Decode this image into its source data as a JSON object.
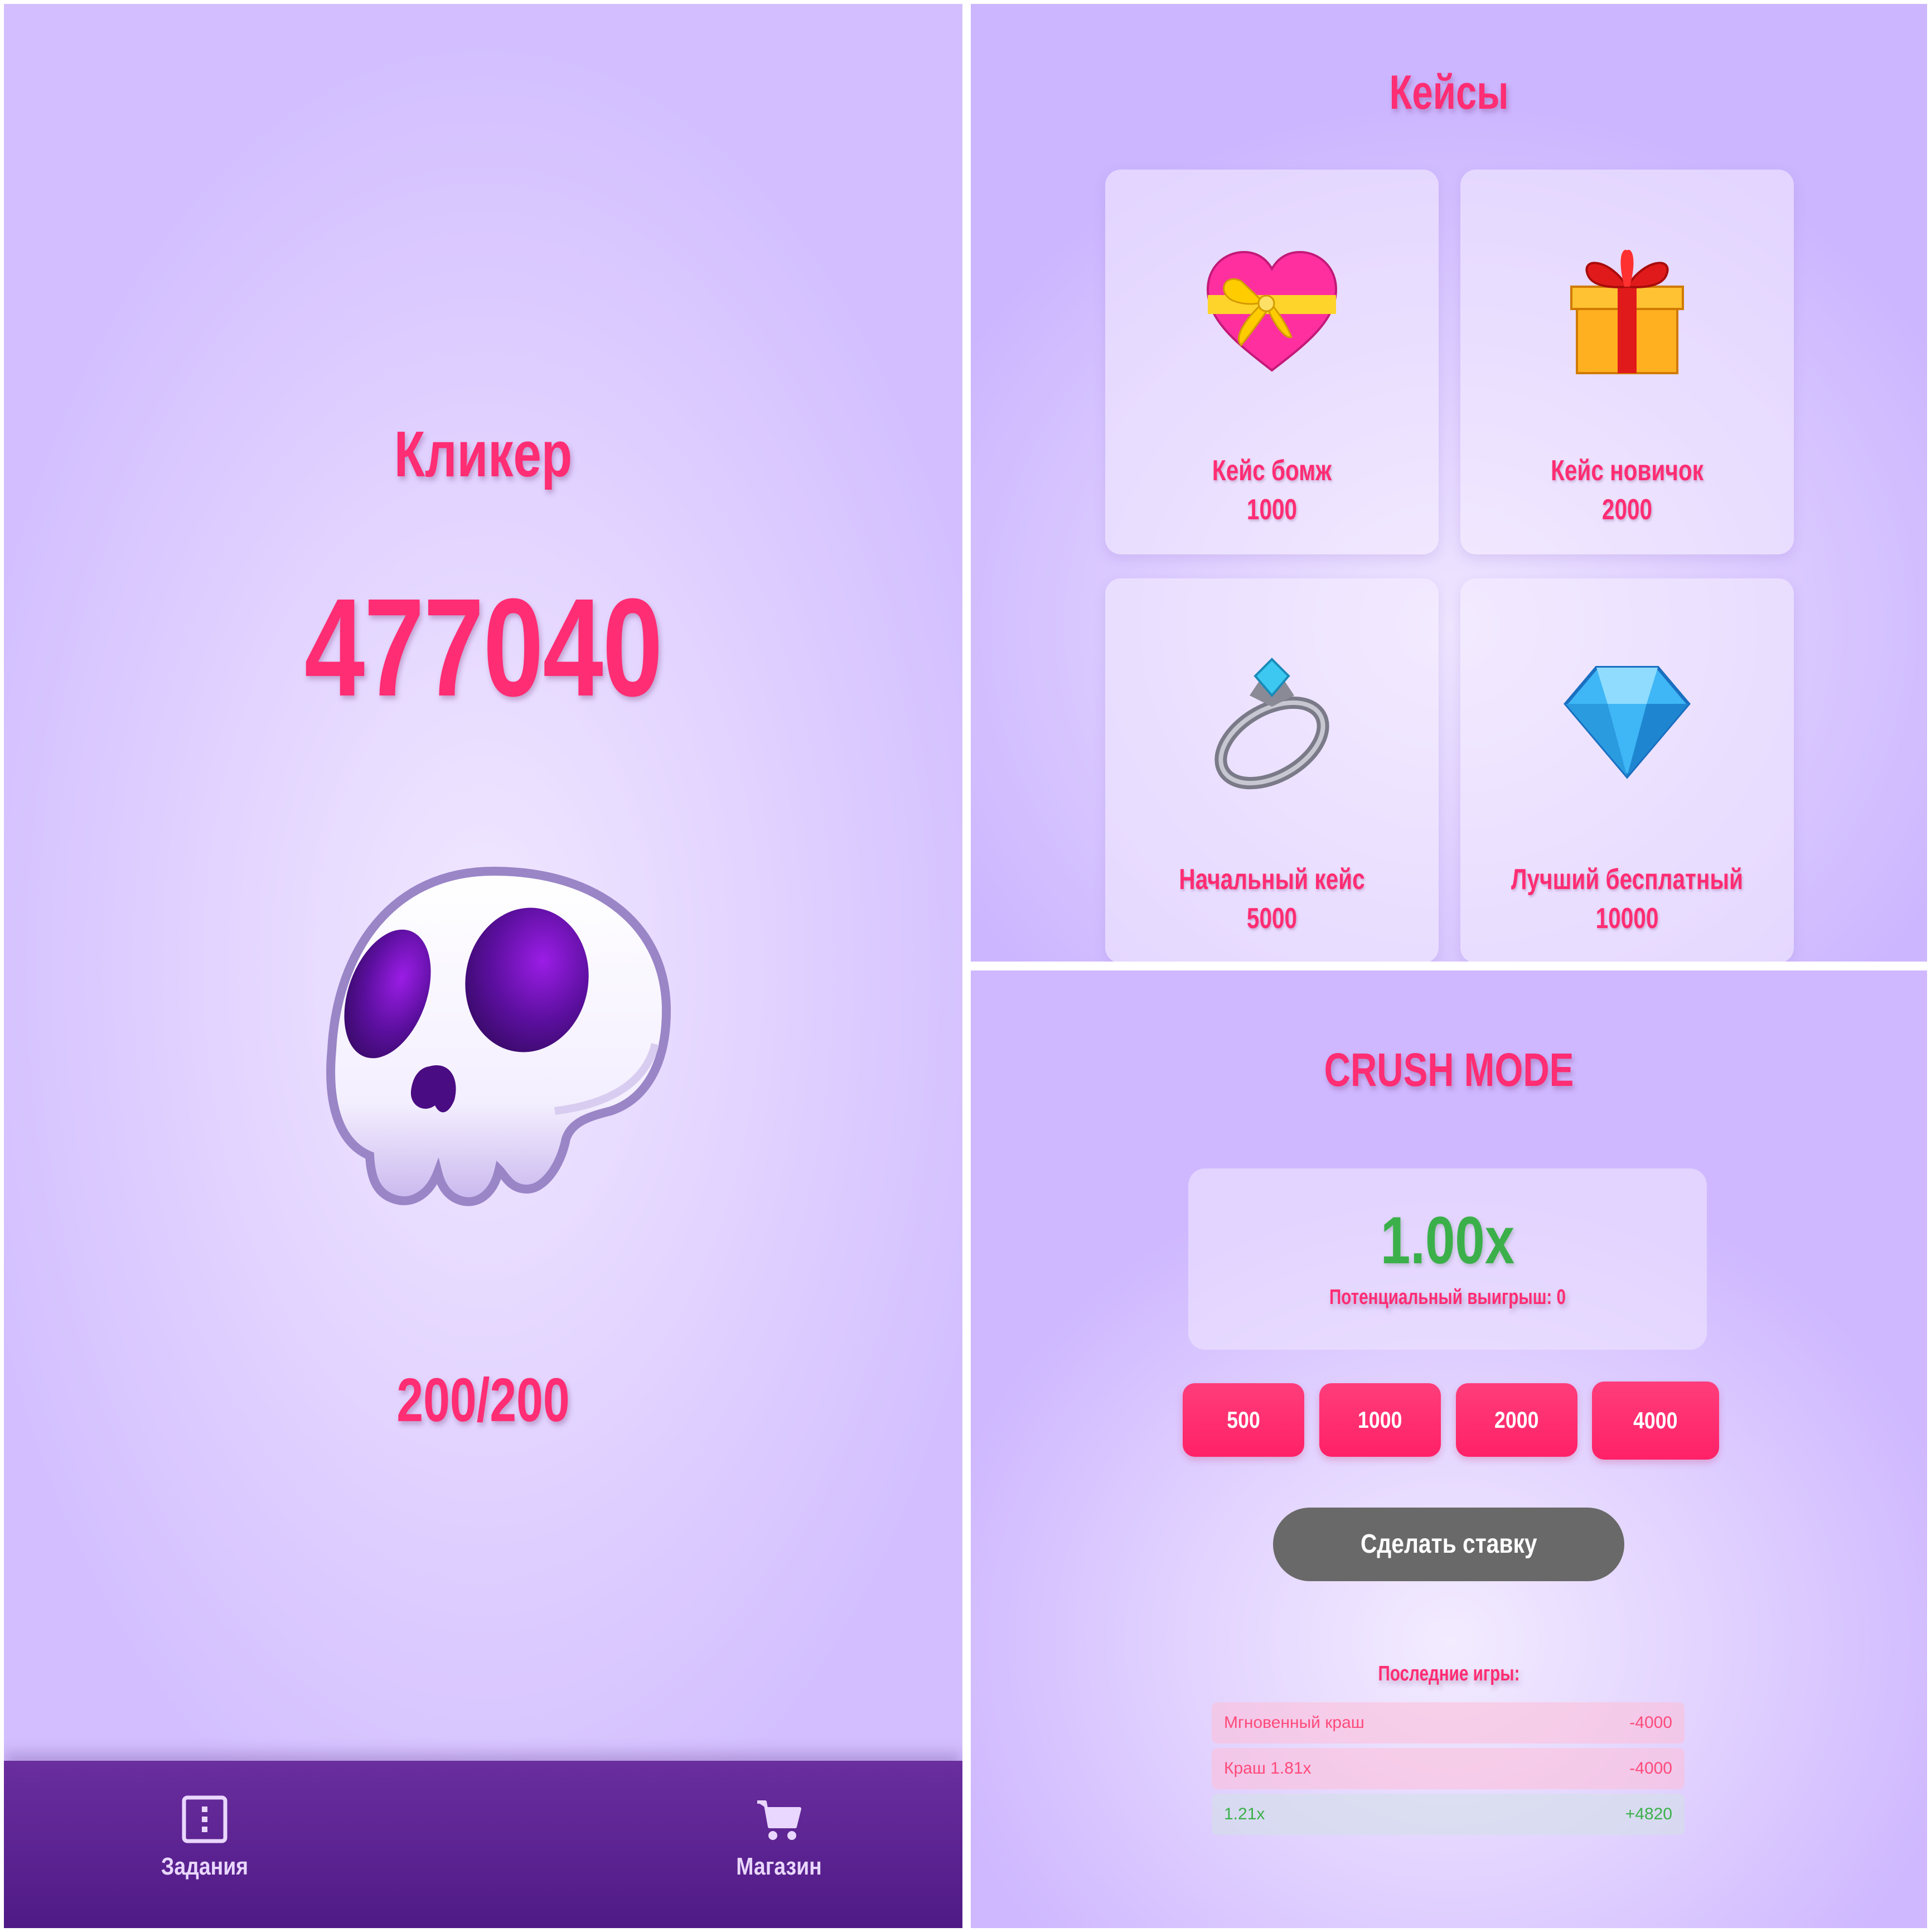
{
  "clicker": {
    "title": "Кликер",
    "score": "477040",
    "energy": "200/200",
    "nav": {
      "tasks_label": "Задания",
      "shop_label": "Магазин"
    }
  },
  "cases": {
    "title": "Кейсы",
    "items": [
      {
        "name": "Кейс бомж",
        "price": "1000",
        "icon": "heart-with-ribbon-icon"
      },
      {
        "name": "Кейс новичок",
        "price": "2000",
        "icon": "gift-icon"
      },
      {
        "name": "Начальный кейс",
        "price": "5000",
        "icon": "ring-icon"
      },
      {
        "name": "Лучший бесплатный",
        "price": "10000",
        "icon": "gem-icon"
      }
    ]
  },
  "crush": {
    "title": "CRUSH MODE",
    "multiplier": "1.00x",
    "potential": "Потенциальный выигрыш: 0",
    "bets": [
      "500",
      "1000",
      "2000",
      "4000"
    ],
    "place_bet_label": "Сделать ставку",
    "history_title": "Последние игры:",
    "history": [
      {
        "text": "Мгновенный краш",
        "amount": "-4000",
        "result": "loss"
      },
      {
        "text": "Краш 1.81x",
        "amount": "-4000",
        "result": "loss"
      },
      {
        "text": "1.21x",
        "amount": "+4820",
        "result": "win"
      }
    ]
  },
  "colors": {
    "accent": "#ff2d73",
    "win": "#3bb04a",
    "nav_bg": "#5a2290",
    "button_gray": "#696969"
  }
}
